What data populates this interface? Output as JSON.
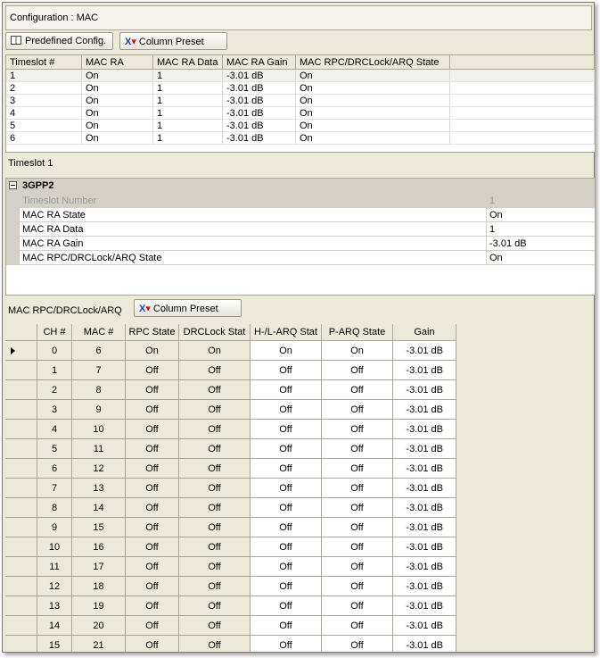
{
  "window": {
    "title": "Configuration : MAC"
  },
  "toolbar": {
    "predefined_label": "Predefined Config.",
    "column_preset_label": "Column Preset"
  },
  "timeslot_table": {
    "headers": [
      "Timeslot #",
      "MAC RA",
      "MAC RA Data",
      "MAC RA Gain",
      "MAC RPC/DRCLock/ARQ State"
    ],
    "rows": [
      [
        "1",
        "On",
        "1",
        "-3.01 dB",
        "On"
      ],
      [
        "2",
        "On",
        "1",
        "-3.01 dB",
        "On"
      ],
      [
        "3",
        "On",
        "1",
        "-3.01 dB",
        "On"
      ],
      [
        "4",
        "On",
        "1",
        "-3.01 dB",
        "On"
      ],
      [
        "5",
        "On",
        "1",
        "-3.01 dB",
        "On"
      ],
      [
        "6",
        "On",
        "1",
        "-3.01 dB",
        "On"
      ]
    ]
  },
  "selected_section": {
    "label": "Timeslot 1"
  },
  "properties": {
    "category": "3GPP2",
    "rows": [
      {
        "name": "Timeslot Number",
        "value": "1",
        "readonly": true
      },
      {
        "name": "MAC RA State",
        "value": "On"
      },
      {
        "name": "MAC RA Data",
        "value": "1"
      },
      {
        "name": "MAC RA Gain",
        "value": "-3.01 dB"
      },
      {
        "name": "MAC RPC/DRCLock/ARQ State",
        "value": "On"
      }
    ]
  },
  "mac_section": {
    "label": "MAC RPC/DRCLock/ARQ",
    "column_preset_label": "Column Preset"
  },
  "mac_table": {
    "headers": [
      "CH #",
      "MAC #",
      "RPC State",
      "DRCLock Stat",
      "H-/L-ARQ Stat",
      "P-ARQ State",
      "Gain"
    ],
    "rows": [
      [
        "0",
        "6",
        "On",
        "On",
        "On",
        "On",
        "-3.01 dB"
      ],
      [
        "1",
        "7",
        "Off",
        "Off",
        "Off",
        "Off",
        "-3.01 dB"
      ],
      [
        "2",
        "8",
        "Off",
        "Off",
        "Off",
        "Off",
        "-3.01 dB"
      ],
      [
        "3",
        "9",
        "Off",
        "Off",
        "Off",
        "Off",
        "-3.01 dB"
      ],
      [
        "4",
        "10",
        "Off",
        "Off",
        "Off",
        "Off",
        "-3.01 dB"
      ],
      [
        "5",
        "11",
        "Off",
        "Off",
        "Off",
        "Off",
        "-3.01 dB"
      ],
      [
        "6",
        "12",
        "Off",
        "Off",
        "Off",
        "Off",
        "-3.01 dB"
      ],
      [
        "7",
        "13",
        "Off",
        "Off",
        "Off",
        "Off",
        "-3.01 dB"
      ],
      [
        "8",
        "14",
        "Off",
        "Off",
        "Off",
        "Off",
        "-3.01 dB"
      ],
      [
        "9",
        "15",
        "Off",
        "Off",
        "Off",
        "Off",
        "-3.01 dB"
      ],
      [
        "10",
        "16",
        "Off",
        "Off",
        "Off",
        "Off",
        "-3.01 dB"
      ],
      [
        "11",
        "17",
        "Off",
        "Off",
        "Off",
        "Off",
        "-3.01 dB"
      ],
      [
        "12",
        "18",
        "Off",
        "Off",
        "Off",
        "Off",
        "-3.01 dB"
      ],
      [
        "13",
        "19",
        "Off",
        "Off",
        "Off",
        "Off",
        "-3.01 dB"
      ],
      [
        "14",
        "20",
        "Off",
        "Off",
        "Off",
        "Off",
        "-3.01 dB"
      ],
      [
        "15",
        "21",
        "Off",
        "Off",
        "Off",
        "Off",
        "-3.01 dB"
      ]
    ]
  }
}
